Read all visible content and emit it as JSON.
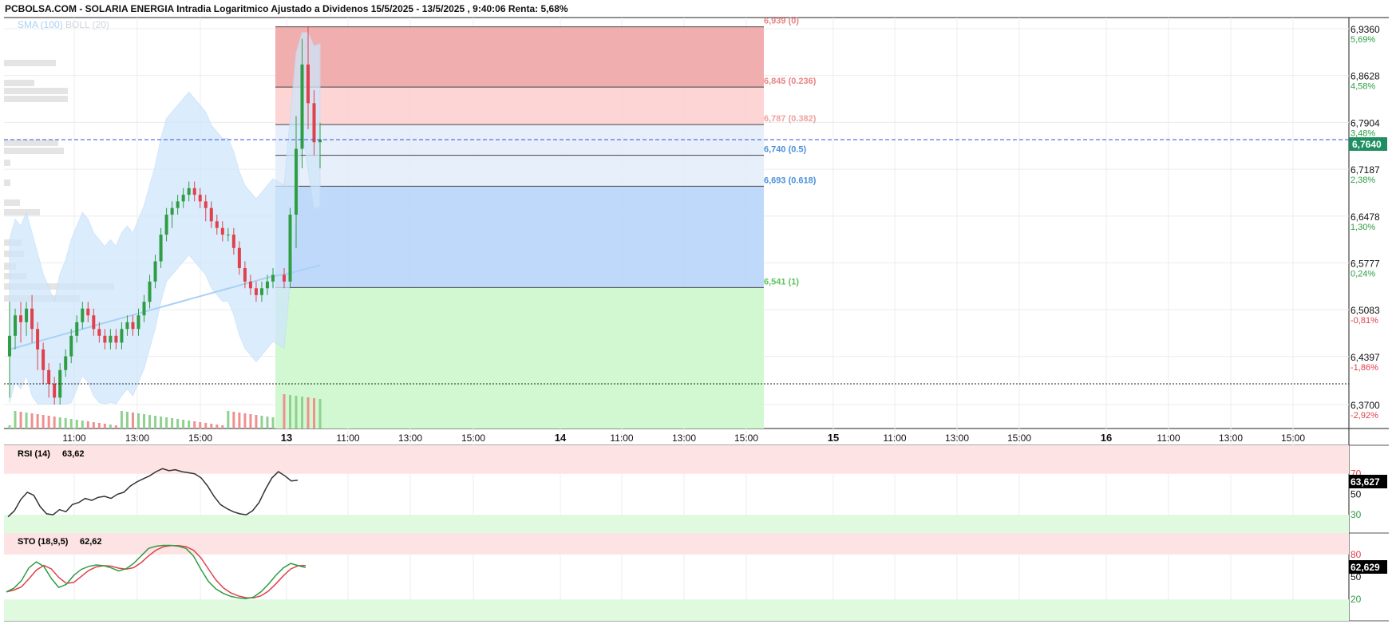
{
  "header": {
    "title": "PCBOLSA.COM - SOLARIA ENERGIA Intradia Logaritmico Ajustado a Dividenos 15/5/2025 - 13/5/2025 , 9:40:06 Renta: 5,68%"
  },
  "legend": {
    "sma": "SMA (100)",
    "boll": "BOLL (20)"
  },
  "colors": {
    "up": "#2e9d44",
    "down": "#e0414b",
    "band": "#cfe6fb",
    "sma": "#a9d1f5",
    "fib_red": "#efaaaa",
    "fib_pink": "#fdd3d3",
    "fib_light": "#e6eefa",
    "fib_blue": "#bcd7fb",
    "fib_green": "#d2f8d2",
    "price_line": "#3a4fe0",
    "last_badge": "#1f8f62"
  },
  "chart_data": [
    {
      "type": "candlestick",
      "title": "SOLARIA ENERGIA",
      "scale": "log",
      "ylim": [
        6.37,
        6.936
      ],
      "y_ticks": [
        {
          "value": "6,9360",
          "pct": "5,69%"
        },
        {
          "value": "6,8628",
          "pct": "4,58%"
        },
        {
          "value": "6,7904",
          "pct": "3,48%"
        },
        {
          "value": "6,7187",
          "pct": "2,38%"
        },
        {
          "value": "6,6478",
          "pct": "1,30%"
        },
        {
          "value": "6,5777",
          "pct": "0,24%"
        },
        {
          "value": "6,5083",
          "pct": "-0,81%"
        },
        {
          "value": "6,4397",
          "pct": "-1,86%"
        },
        {
          "value": "6,3700",
          "pct": "-2,92%"
        }
      ],
      "x_ticks": [
        "11:00",
        "13:00",
        "15:00",
        "13",
        "11:00",
        "13:00",
        "15:00",
        "14",
        "11:00",
        "13:00",
        "15:00",
        "15",
        "11:00",
        "13:00",
        "15:00",
        "16",
        "11:00",
        "13:00",
        "15:00"
      ],
      "last_price": "6,7640",
      "last_price_value": 6.764,
      "prev_close_value": 6.4,
      "fibonacci": [
        {
          "label": "6,939 (0)",
          "price": 6.939
        },
        {
          "label": "6,845 (0.236)",
          "price": 6.845
        },
        {
          "label": "6,787 (0.382)",
          "price": 6.787
        },
        {
          "label": "6,740 (0.5)",
          "price": 6.74
        },
        {
          "label": "6,693 (0.618)",
          "price": 6.693
        },
        {
          "label": "6,541 (1)",
          "price": 6.541
        }
      ],
      "candles": [
        [
          6.44,
          6.47,
          6.38,
          6.52
        ],
        [
          6.47,
          6.5,
          6.45,
          6.51
        ],
        [
          6.5,
          6.49,
          6.46,
          6.52
        ],
        [
          6.49,
          6.51,
          6.47,
          6.52
        ],
        [
          6.51,
          6.48,
          6.46,
          6.53
        ],
        [
          6.48,
          6.45,
          6.42,
          6.49
        ],
        [
          6.45,
          6.42,
          6.4,
          6.46
        ],
        [
          6.42,
          6.4,
          6.38,
          6.43
        ],
        [
          6.4,
          6.38,
          6.37,
          6.41
        ],
        [
          6.38,
          6.42,
          6.37,
          6.43
        ],
        [
          6.42,
          6.44,
          6.41,
          6.45
        ],
        [
          6.44,
          6.47,
          6.43,
          6.48
        ],
        [
          6.47,
          6.49,
          6.46,
          6.5
        ],
        [
          6.49,
          6.51,
          6.48,
          6.52
        ],
        [
          6.51,
          6.5,
          6.49,
          6.52
        ],
        [
          6.5,
          6.48,
          6.47,
          6.51
        ],
        [
          6.48,
          6.47,
          6.46,
          6.49
        ],
        [
          6.47,
          6.46,
          6.45,
          6.48
        ],
        [
          6.46,
          6.47,
          6.45,
          6.48
        ],
        [
          6.47,
          6.46,
          6.45,
          6.48
        ],
        [
          6.46,
          6.48,
          6.45,
          6.49
        ],
        [
          6.48,
          6.49,
          6.47,
          6.5
        ],
        [
          6.49,
          6.48,
          6.47,
          6.5
        ],
        [
          6.48,
          6.5,
          6.47,
          6.51
        ],
        [
          6.5,
          6.52,
          6.49,
          6.53
        ],
        [
          6.52,
          6.55,
          6.51,
          6.56
        ],
        [
          6.55,
          6.58,
          6.54,
          6.59
        ],
        [
          6.58,
          6.62,
          6.57,
          6.63
        ],
        [
          6.62,
          6.65,
          6.61,
          6.66
        ],
        [
          6.65,
          6.66,
          6.63,
          6.67
        ],
        [
          6.66,
          6.67,
          6.65,
          6.68
        ],
        [
          6.67,
          6.68,
          6.66,
          6.69
        ],
        [
          6.68,
          6.69,
          6.67,
          6.7
        ],
        [
          6.69,
          6.68,
          6.67,
          6.7
        ],
        [
          6.68,
          6.67,
          6.66,
          6.69
        ],
        [
          6.67,
          6.66,
          6.64,
          6.68
        ],
        [
          6.66,
          6.64,
          6.63,
          6.67
        ],
        [
          6.64,
          6.63,
          6.62,
          6.65
        ],
        [
          6.63,
          6.62,
          6.61,
          6.64
        ],
        [
          6.62,
          6.62,
          6.61,
          6.63
        ],
        [
          6.62,
          6.6,
          6.59,
          6.63
        ],
        [
          6.6,
          6.57,
          6.56,
          6.61
        ],
        [
          6.57,
          6.55,
          6.54,
          6.58
        ],
        [
          6.55,
          6.54,
          6.53,
          6.56
        ],
        [
          6.54,
          6.53,
          6.52,
          6.55
        ],
        [
          6.53,
          6.54,
          6.52,
          6.55
        ],
        [
          6.54,
          6.55,
          6.53,
          6.56
        ],
        [
          6.55,
          6.56,
          6.54,
          6.57
        ],
        [
          6.56,
          6.55,
          6.54,
          6.57
        ],
        [
          6.55,
          6.65,
          6.54,
          6.66
        ],
        [
          6.65,
          6.75,
          6.6,
          6.8
        ],
        [
          6.75,
          6.88,
          6.72,
          6.92
        ],
        [
          6.88,
          6.82,
          6.78,
          6.94
        ],
        [
          6.82,
          6.76,
          6.74,
          6.84
        ],
        [
          6.76,
          6.764,
          6.72,
          6.79
        ]
      ]
    },
    {
      "type": "line",
      "name": "RSI (14)",
      "value_label": "63,62",
      "last_value": "63,627",
      "levels": [
        "70",
        "50",
        "30"
      ],
      "values": [
        28,
        34,
        45,
        52,
        49,
        38,
        31,
        30,
        35,
        33,
        40,
        42,
        46,
        44,
        47,
        48,
        46,
        50,
        52,
        58,
        62,
        65,
        68,
        72,
        75,
        73,
        74,
        72,
        71,
        70,
        66,
        58,
        48,
        40,
        36,
        33,
        31,
        30,
        34,
        42,
        55,
        66,
        72,
        68,
        63,
        63.6
      ]
    },
    {
      "type": "line",
      "name": "STO (18,9,5)",
      "value_label": "62,62",
      "last_value": "62,629",
      "levels": [
        "80",
        "50",
        "20"
      ],
      "values": [
        30,
        35,
        45,
        62,
        70,
        64,
        48,
        36,
        40,
        52,
        60,
        64,
        66,
        65,
        62,
        58,
        61,
        68,
        78,
        88,
        91,
        92,
        92,
        91,
        88,
        78,
        60,
        44,
        34,
        28,
        24,
        22,
        21,
        23,
        30,
        40,
        52,
        62,
        68,
        65,
        62.6
      ]
    }
  ]
}
